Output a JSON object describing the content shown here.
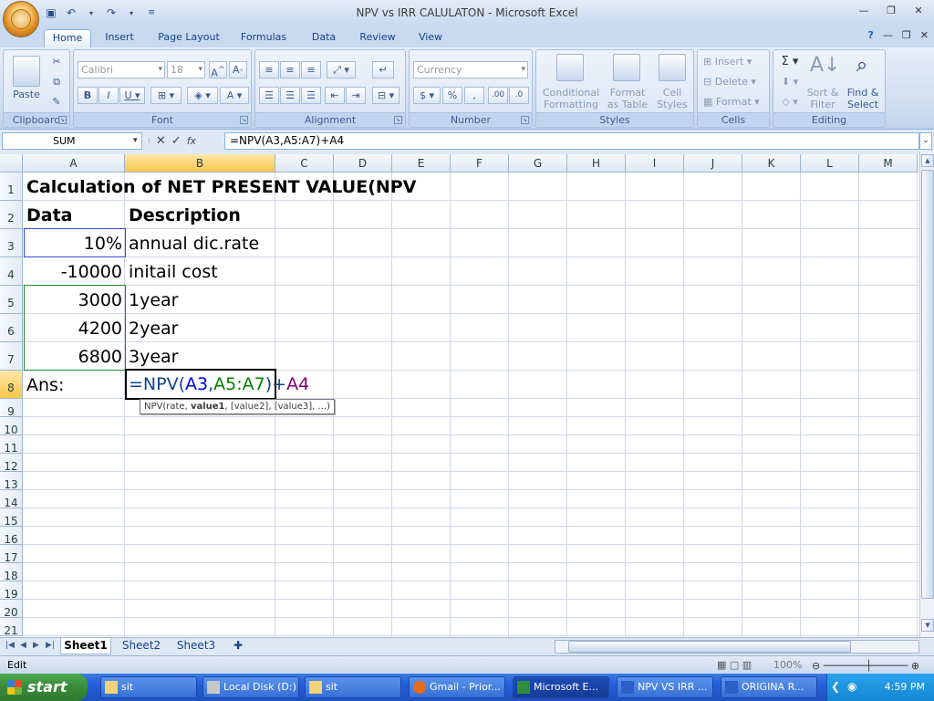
{
  "window": {
    "title": "NPV vs IRR CALULATON - Microsoft Excel"
  },
  "ribbon": {
    "tabs": [
      "Home",
      "Insert",
      "Page Layout",
      "Formulas",
      "Data",
      "Review",
      "View"
    ],
    "active_tab": "Home",
    "groups": {
      "clipboard": {
        "label": "Clipboard",
        "paste": "Paste"
      },
      "font": {
        "label": "Font",
        "font_name": "Calibri",
        "font_size": "18"
      },
      "alignment": {
        "label": "Alignment"
      },
      "number": {
        "label": "Number",
        "format": "Currency"
      },
      "styles": {
        "label": "Styles",
        "conditional": "Conditional Formatting",
        "format_table": "Format as Table",
        "cell_styles": "Cell Styles"
      },
      "cells": {
        "label": "Cells",
        "insert": "Insert",
        "delete": "Delete",
        "format": "Format"
      },
      "editing": {
        "label": "Editing",
        "sort": "Sort & Filter",
        "find": "Find & Select"
      }
    }
  },
  "formula_bar": {
    "name_box": "SUM",
    "formula": "=NPV(A3,A5:A7)+A4"
  },
  "grid": {
    "columns": [
      "A",
      "B",
      "C",
      "D",
      "E",
      "F",
      "G",
      "H",
      "I",
      "J",
      "K",
      "L",
      "M"
    ],
    "rows": [
      "1",
      "2",
      "3",
      "4",
      "5",
      "6",
      "7",
      "8",
      "9",
      "10",
      "11",
      "12",
      "13",
      "14",
      "15",
      "16",
      "17",
      "18",
      "19",
      "20",
      "21"
    ],
    "cells": {
      "A1": "Calculation of NET PRESENT VALUE(NPV",
      "A2": "Data",
      "B2": "Description",
      "A3": "10%",
      "B3": "annual dic.rate",
      "A4": "-10000",
      "B4": "initail cost",
      "A5": "3000",
      "B5": "1year",
      "A6": "4200",
      "B6": "2year",
      "A7": "6800",
      "B7": "3year",
      "A8": "Ans:"
    },
    "edit": {
      "prefix": "=NPV(",
      "ref1": "A3",
      "sep": ",",
      "ref2": "A5:A7",
      "mid": ")+",
      "ref3": "A4"
    },
    "tooltip": {
      "fn": "NPV(rate, ",
      "bold": "value1",
      "rest": ", [value2], [value3], ...)"
    },
    "ref_colors": {
      "A3": "#0000ff",
      "A5:A7": "#008000",
      "A4": "#800080"
    }
  },
  "sheets": [
    "Sheet1",
    "Sheet2",
    "Sheet3"
  ],
  "active_sheet": "Sheet1",
  "status": {
    "mode": "Edit",
    "zoom": "100%"
  },
  "taskbar": {
    "start": "start",
    "items": [
      "sit",
      "Local Disk (D:)",
      "sit",
      "Gmail - Prior...",
      "Microsoft E...",
      "NPV VS IRR ...",
      "ORIGINA R..."
    ],
    "active_item": "Microsoft E...",
    "clock": "4:59 PM"
  }
}
